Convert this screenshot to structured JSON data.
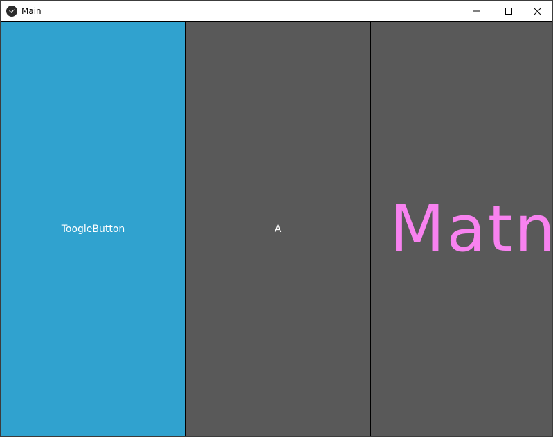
{
  "window": {
    "title": "Main",
    "icon": "kivy-logo-icon",
    "controls": {
      "minimize": "minimize-icon",
      "maximize": "maximize-icon",
      "close": "close-icon"
    }
  },
  "buttons": {
    "toggle_label": "ToogleButton",
    "a_label": "A"
  },
  "label": {
    "text": "Matn",
    "color": "#f882f0"
  },
  "colors": {
    "toggle_active": "#30a2cf",
    "button_normal": "#595959"
  }
}
